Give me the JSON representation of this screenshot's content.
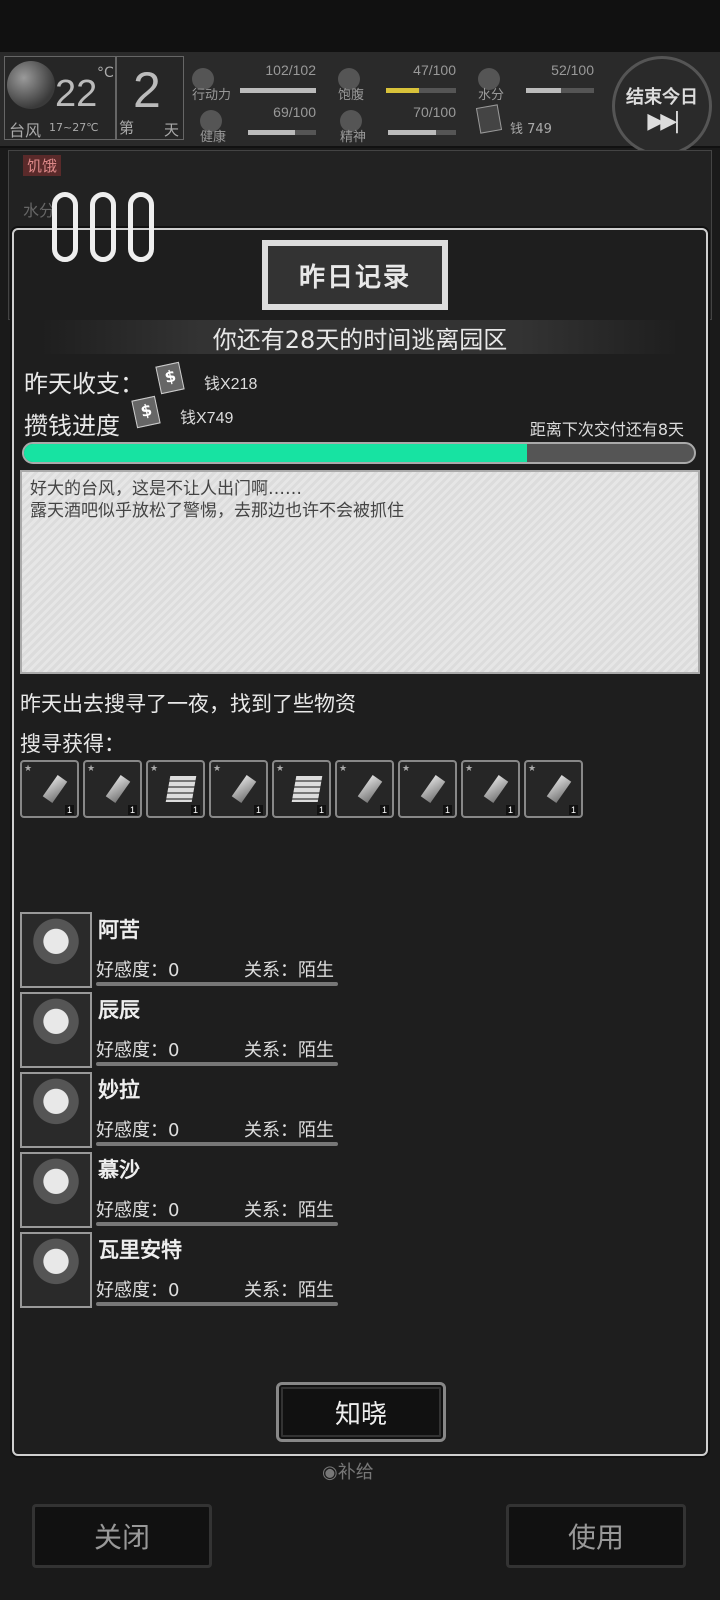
{
  "hud": {
    "weather": {
      "temp": "22",
      "deg": "°C",
      "name": "台风",
      "range": "17~27℃",
      "icon": "moon-icon"
    },
    "day": {
      "number": "2",
      "left": "第",
      "right": "天"
    },
    "stats": [
      {
        "key": "action",
        "label": "行动力",
        "value": "102/102",
        "fraction": 1.0,
        "icon": "footprint-icon"
      },
      {
        "key": "satiety",
        "label": "饱腹",
        "value": "47/100",
        "fraction": 0.47,
        "icon": "stomach-icon"
      },
      {
        "key": "water",
        "label": "水分",
        "value": "52/100",
        "fraction": 0.52,
        "icon": "water-drop-icon"
      },
      {
        "key": "health",
        "label": "健康",
        "value": "69/100",
        "fraction": 0.69,
        "icon": "heart-icon"
      },
      {
        "key": "spirit",
        "label": "精神",
        "value": "70/100",
        "fraction": 0.7,
        "icon": "brain-icon"
      }
    ],
    "money": "钱 749",
    "end_day": "结束今日",
    "end_day_icon": "▶▶|"
  },
  "background": {
    "hunger_badge": "饥饿",
    "peek_text": "水分"
  },
  "modal": {
    "title": "昨日记录",
    "deadline": "你还有28天的时间逃离园区",
    "yesterday_label": "昨天收支：",
    "yesterday_value": "钱X218",
    "saving_label": "攒钱进度",
    "saving_value": "钱X749",
    "next_due": "距离下次交付还有8天",
    "progress_fraction": 0.75,
    "progress_color": "#17e3a2",
    "log": [
      "好大的台风，这是不让人出门啊……",
      "露天酒吧似乎放松了警惕，去那边也许不会被抓住"
    ],
    "found_text": "昨天出去搜寻了一夜，找到了些物资",
    "gains_label": "搜寻获得：",
    "items": [
      {
        "icon": "can-icon",
        "count": "1"
      },
      {
        "icon": "cigarette-icon",
        "count": "1"
      },
      {
        "icon": "paper-stack-icon",
        "count": "1"
      },
      {
        "icon": "scrap-icon",
        "count": "1"
      },
      {
        "icon": "paper-stack-icon",
        "count": "1"
      },
      {
        "icon": "water-bottle-icon",
        "count": "1"
      },
      {
        "icon": "tube-icon",
        "count": "1"
      },
      {
        "icon": "tube-icon",
        "count": "1"
      },
      {
        "icon": "bandage-icon",
        "count": "1"
      }
    ],
    "characters": [
      {
        "name": "阿苦",
        "favor": "好感度：0",
        "relation": "关系：陌生"
      },
      {
        "name": "辰辰",
        "favor": "好感度：0",
        "relation": "关系：陌生"
      },
      {
        "name": "妙拉",
        "favor": "好感度：0",
        "relation": "关系：陌生"
      },
      {
        "name": "慕沙",
        "favor": "好感度：0",
        "relation": "关系：陌生"
      },
      {
        "name": "瓦里安特",
        "favor": "好感度：0",
        "relation": "关系：陌生"
      }
    ],
    "ack_button": "知晓"
  },
  "footer": {
    "supply": "◉补给",
    "close": "关闭",
    "use": "使用"
  }
}
